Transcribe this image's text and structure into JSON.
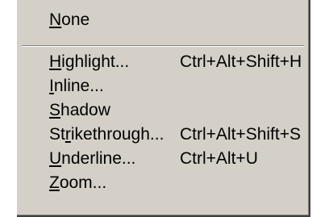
{
  "menu": {
    "items": [
      {
        "id": "none",
        "label": "None",
        "mnemonic_index": 0,
        "shortcut": ""
      },
      {
        "id": "highlight",
        "label": "Highlight...",
        "mnemonic_index": 0,
        "shortcut": "Ctrl+Alt+Shift+H"
      },
      {
        "id": "inline",
        "label": "Inline...",
        "mnemonic_index": 0,
        "shortcut": ""
      },
      {
        "id": "shadow",
        "label": "Shadow",
        "mnemonic_index": 0,
        "shortcut": ""
      },
      {
        "id": "strikethrough",
        "label": "Strikethrough...",
        "mnemonic_index": 2,
        "shortcut": "Ctrl+Alt+Shift+S"
      },
      {
        "id": "underline",
        "label": "Underline...",
        "mnemonic_index": 0,
        "shortcut": "Ctrl+Alt+U"
      },
      {
        "id": "zoom",
        "label": "Zoom...",
        "mnemonic_index": 0,
        "shortcut": ""
      }
    ]
  },
  "colors": {
    "menu_background": "#d4d0c8",
    "text": "#000000",
    "separator_dark": "#808080",
    "separator_light": "#ffffff"
  }
}
